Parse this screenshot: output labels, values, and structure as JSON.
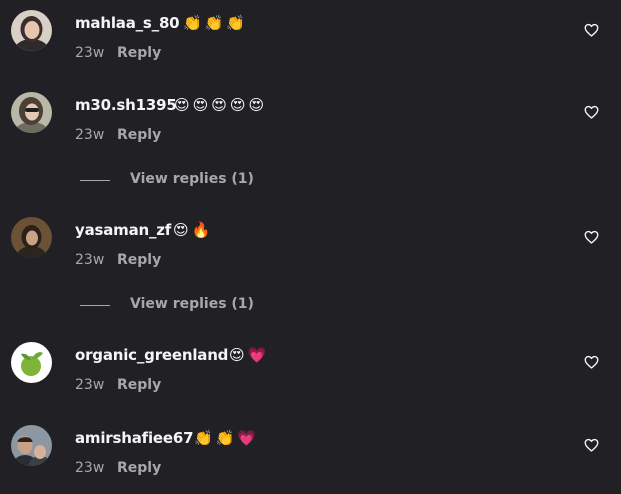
{
  "colors": {
    "background": "#212125",
    "username": "#f5f5f5",
    "secondary_text": "#a8a8a8"
  },
  "comments": [
    {
      "username": "mahlaa_s_80",
      "emojis": "👏👏👏",
      "time": "23w",
      "reply_label": "Reply",
      "like_icon": "heart-outline-icon"
    },
    {
      "username": "m30.sh1395",
      "emojis": "😍😍😍😍😍",
      "time": "23w",
      "reply_label": "Reply",
      "like_icon": "heart-outline-icon",
      "view_replies": "View replies (1)"
    },
    {
      "username": "yasaman_zf",
      "emojis": "😍🔥",
      "time": "23w",
      "reply_label": "Reply",
      "like_icon": "heart-outline-icon",
      "view_replies": "View replies (1)"
    },
    {
      "username": "organic_greenland",
      "emojis": "😍💗",
      "time": "23w",
      "reply_label": "Reply",
      "like_icon": "heart-outline-icon"
    },
    {
      "username": "amirshafiee67",
      "emojis": "👏👏💗",
      "time": "23w",
      "reply_label": "Reply",
      "like_icon": "heart-outline-icon"
    }
  ]
}
